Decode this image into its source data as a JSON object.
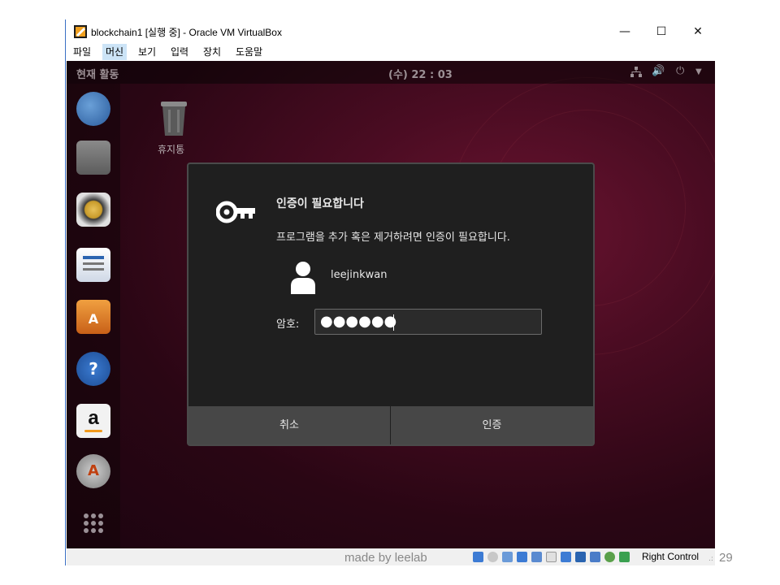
{
  "window": {
    "title": "blockchain1 [실행 중] - Oracle VM VirtualBox",
    "minimize": "—",
    "maximize": "☐",
    "close": "✕"
  },
  "menu": [
    "파일",
    "머신",
    "보기",
    "입력",
    "장치",
    "도움말"
  ],
  "menu_active": "머신",
  "ubuntu": {
    "activities": "현재 활동",
    "clock": "(수) 22 : 03",
    "tray": [
      "network-icon",
      "volume-icon",
      "power-icon",
      "dropdown-arrow-icon"
    ],
    "desktop_trash_label": "휴지통",
    "dock": [
      "thunderbird-icon",
      "files-icon",
      "rhythmbox-icon",
      "libreoffice-writer-icon",
      "software-center-icon",
      "help-icon",
      "amazon-icon",
      "software-updater-icon",
      "show-apps-icon"
    ]
  },
  "dialog": {
    "title": "인증이 필요합니다",
    "message": "프로그램을 추가 혹은 제거하려면 인증이 필요합니다.",
    "username": "leejinkwan",
    "password_label": "암호:",
    "password_value": "●●●●●●",
    "cancel": "취소",
    "authenticate": "인증"
  },
  "statusbar": {
    "watermark": "made by leelab",
    "host_key": "Right Control"
  },
  "slide_number": "29"
}
